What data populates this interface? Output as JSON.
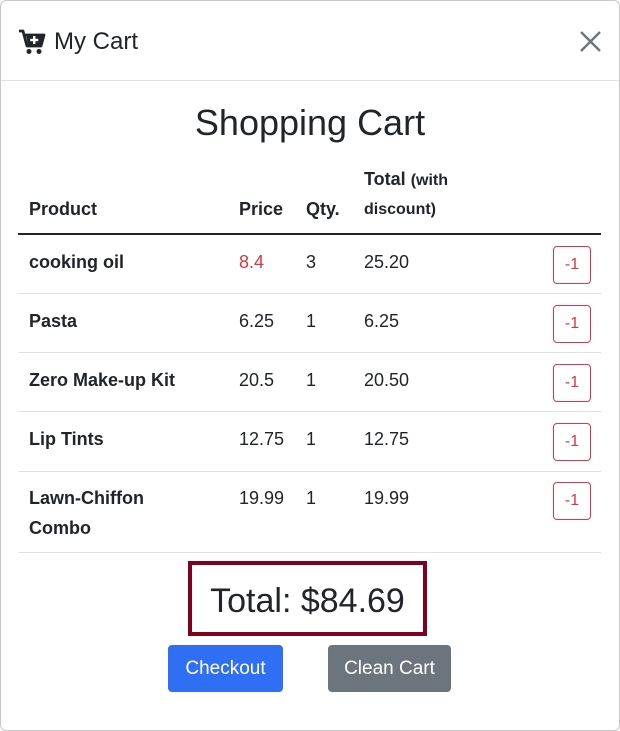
{
  "modal": {
    "title": "My Cart",
    "icons": {
      "cart": "cart-icon",
      "close": "close-icon"
    }
  },
  "heading": "Shopping Cart",
  "table": {
    "headers": {
      "product": "Product",
      "price": "Price",
      "qty": "Qty.",
      "total_line1": "Total",
      "total_line1_small": "(with",
      "total_line2": "discount)"
    },
    "rows": [
      {
        "name": "cooking oil",
        "price": "8.4",
        "qty": "3",
        "total": "25.20",
        "action": "-1",
        "price_highlight": true
      },
      {
        "name": "Pasta",
        "price": "6.25",
        "qty": "1",
        "total": "6.25",
        "action": "-1"
      },
      {
        "name": "Zero Make-up Kit",
        "price": "20.5",
        "qty": "1",
        "total": "20.50",
        "action": "-1"
      },
      {
        "name": "Lip Tints",
        "price": "12.75",
        "qty": "1",
        "total": "12.75",
        "action": "-1"
      },
      {
        "name": "Lawn-Chiffon Combo",
        "price": "19.99",
        "qty": "1",
        "total": "19.99",
        "action": "-1"
      }
    ]
  },
  "summary": {
    "total_label": "Total: $84.69"
  },
  "buttons": {
    "checkout": "Checkout",
    "clean": "Clean Cart"
  },
  "colors": {
    "primary": "#2f6ff4",
    "secondary": "#6c757d",
    "danger": "#dc3545",
    "total_border": "#800020"
  }
}
